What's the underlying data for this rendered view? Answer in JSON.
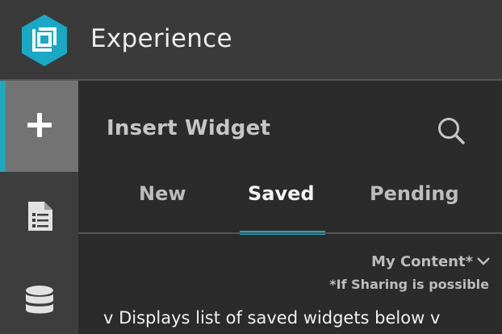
{
  "app": {
    "title": "Experience",
    "logo_icon": "experience-logo",
    "accent_color": "#1ea7bd"
  },
  "rail": {
    "items": [
      {
        "icon": "plus-icon",
        "active": true
      },
      {
        "icon": "document-list-icon",
        "active": false
      },
      {
        "icon": "database-icon",
        "active": false
      }
    ]
  },
  "panel": {
    "title": "Insert Widget",
    "search_icon": "search-icon",
    "tabs": [
      {
        "label": "New",
        "selected": false
      },
      {
        "label": "Saved",
        "selected": true
      },
      {
        "label": "Pending",
        "selected": false
      }
    ],
    "filter": {
      "label": "My Content*",
      "icon": "chevron-down-icon"
    },
    "sharing_note": "*If Sharing is possible",
    "list_hint": "v Displays list of saved widgets below v"
  }
}
